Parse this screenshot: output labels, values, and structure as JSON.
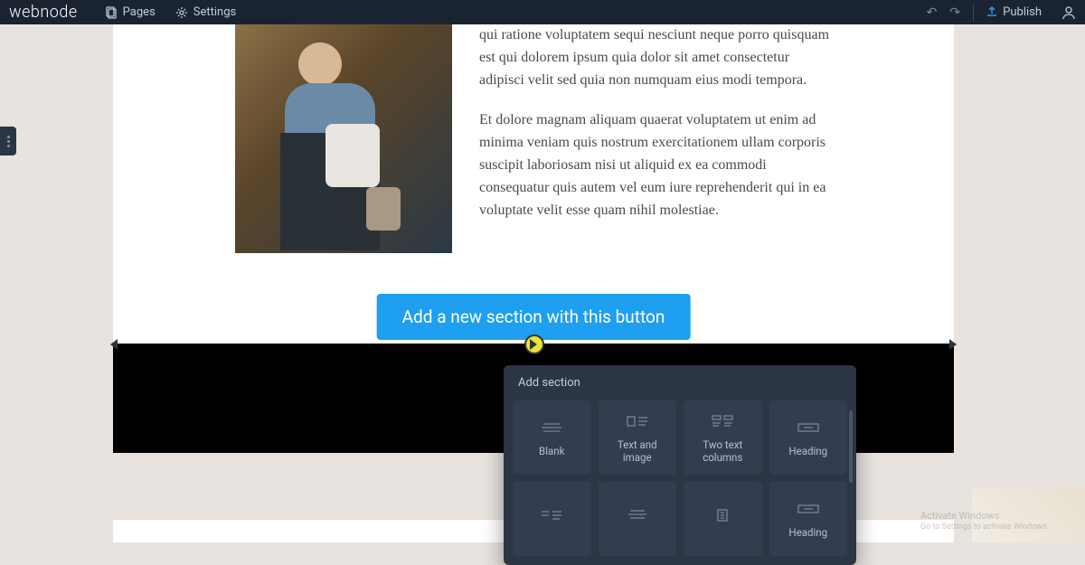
{
  "topbar": {
    "logo": "webnode",
    "pages": "Pages",
    "settings": "Settings",
    "publish": "Publish"
  },
  "content": {
    "para1": "qui ratione voluptatem sequi nesciunt neque porro quisquam est qui dolorem ipsum quia dolor sit amet consectetur adipisci velit sed quia non numquam eius modi tempora.",
    "para2": "Et dolore magnam aliquam quaerat voluptatem ut enim ad minima veniam quis nostrum exercitationem ullam corporis suscipit laboriosam nisi ut aliquid ex ea commodi consequatur quis autem vel eum iure reprehenderit qui in ea voluptate velit esse quam nihil molestiae.",
    "cta": "Add a new section with this button"
  },
  "popover": {
    "title": "Add section",
    "items": [
      {
        "label": "Blank"
      },
      {
        "label": "Text and image"
      },
      {
        "label": "Two text columns"
      },
      {
        "label": "Heading"
      },
      {
        "label": ""
      },
      {
        "label": ""
      },
      {
        "label": ""
      },
      {
        "label": "Heading"
      }
    ]
  },
  "watermark": {
    "line1": "Activate Windows",
    "line2": "Go to Settings to activate Windows."
  }
}
